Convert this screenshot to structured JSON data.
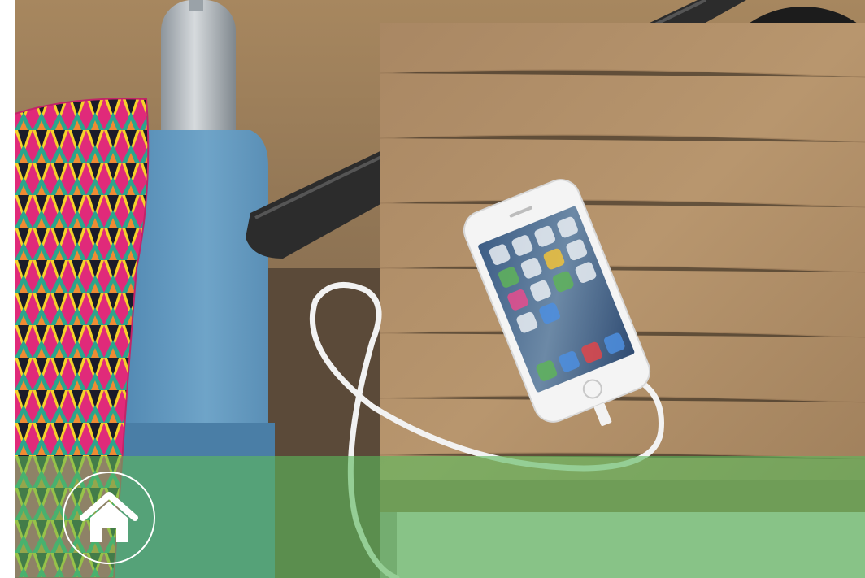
{
  "photo": {
    "subject": "smartphone-charging-on-bedside-table",
    "elements": [
      "decorative-cushion",
      "blue-upholstered-chair",
      "wooden-bedside-table",
      "white-smartphone",
      "white-charging-cable",
      "black-desk-lamp"
    ]
  },
  "overlay": {
    "band_color": "#5cb85c"
  },
  "home_button": {
    "icon": "home-icon",
    "border_color": "#ffffff"
  }
}
